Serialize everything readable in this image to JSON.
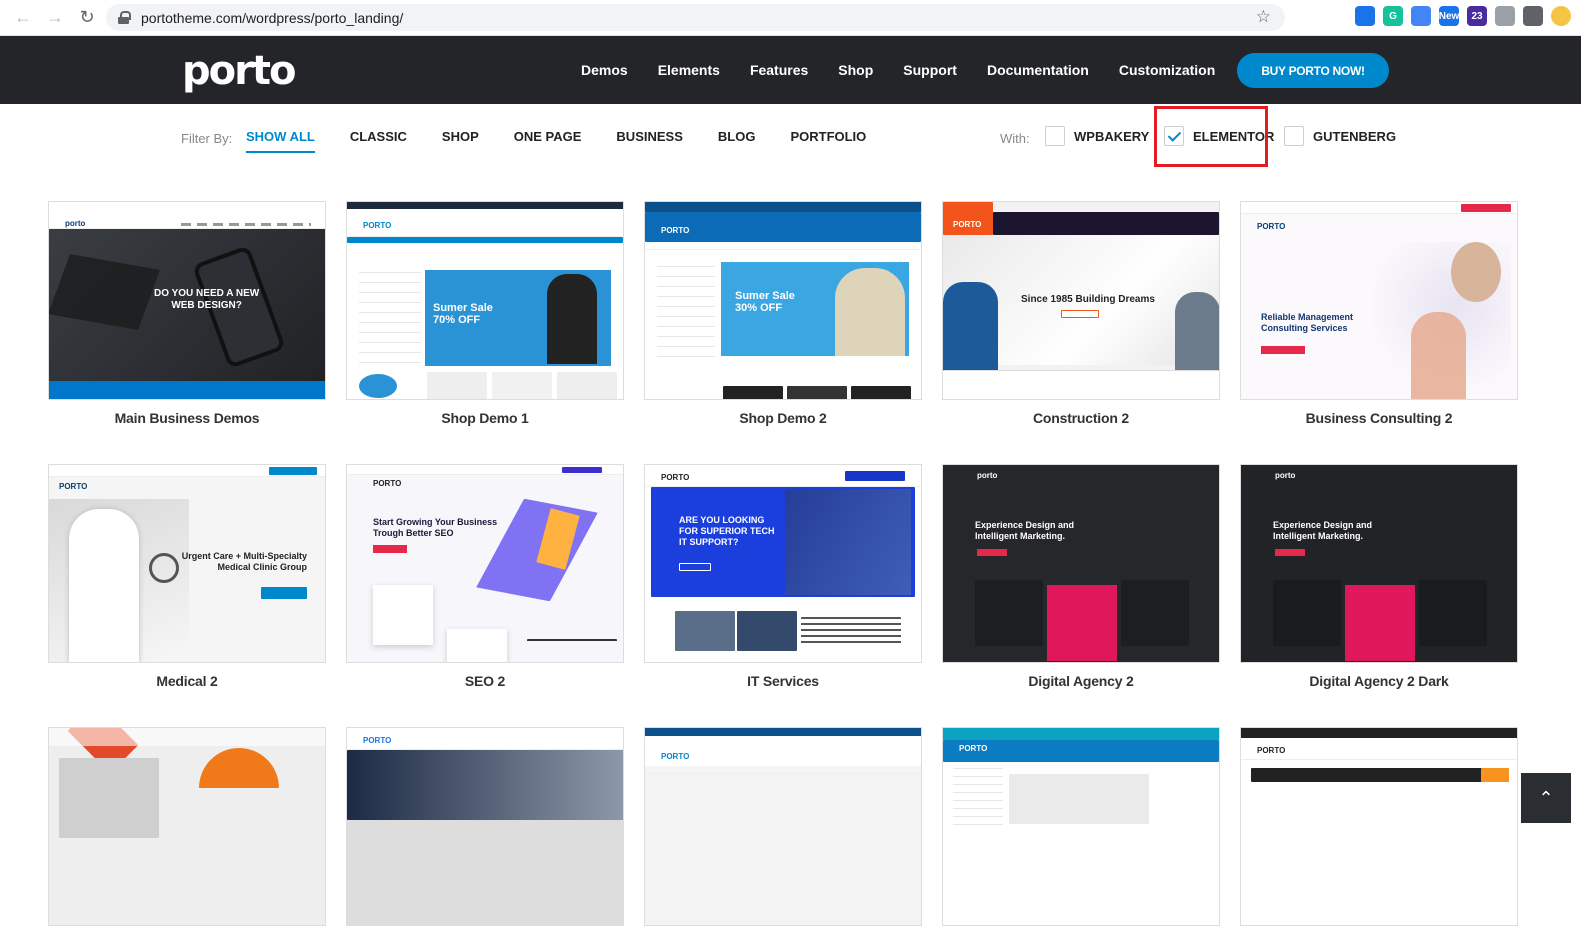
{
  "browser": {
    "url": "portotheme.com/wordpress/porto_landing/",
    "extensions": [
      {
        "name": "share-icon",
        "color": "#1a73e8",
        "label": ""
      },
      {
        "name": "grammarly-icon",
        "color": "#15c39a",
        "label": "G"
      },
      {
        "name": "translate-icon",
        "color": "#4285f4",
        "label": ""
      },
      {
        "name": "new-badge-icon",
        "color": "#1a73e8",
        "label": "New"
      },
      {
        "name": "mortarboard-icon",
        "color": "#4b2ca0",
        "label": "23"
      },
      {
        "name": "globe-icon",
        "color": "#9aa0a6",
        "label": ""
      },
      {
        "name": "puzzle-icon",
        "color": "#5f6368",
        "label": ""
      },
      {
        "name": "profile-avatar-icon",
        "color": "#f4c542",
        "label": ""
      }
    ]
  },
  "header": {
    "logo": "porto",
    "nav": [
      "Demos",
      "Elements",
      "Features",
      "Shop",
      "Support",
      "Documentation",
      "Customization"
    ],
    "buy_label": "BUY PORTO NOW!"
  },
  "filters": {
    "label": "Filter By:",
    "items": [
      "SHOW ALL",
      "CLASSIC",
      "SHOP",
      "ONE PAGE",
      "BUSINESS",
      "BLOG",
      "PORTFOLIO"
    ],
    "active": "SHOW ALL",
    "with_label": "With:",
    "builders": [
      {
        "label": "WPBAKERY",
        "checked": false
      },
      {
        "label": "ELEMENTOR",
        "checked": true
      },
      {
        "label": "GUTENBERG",
        "checked": false
      }
    ]
  },
  "demos": [
    {
      "title": "Main Business Demos",
      "hero": "DO YOU NEED A NEW\nWEB DESIGN?"
    },
    {
      "title": "Shop Demo 1",
      "hero": "Sumer Sale\n70% OFF"
    },
    {
      "title": "Shop Demo 2",
      "hero": "Sumer Sale\n30% OFF"
    },
    {
      "title": "Construction 2",
      "hero": "Since 1985 Building Dreams"
    },
    {
      "title": "Business Consulting 2",
      "hero": "Reliable Management\nConsulting Services"
    },
    {
      "title": "Medical 2",
      "hero": "Urgent Care + Multi-Specialty\nMedical Clinic Group"
    },
    {
      "title": "SEO 2",
      "hero": "Start Growing Your Business\nTrough Better SEO"
    },
    {
      "title": "IT Services",
      "hero": "ARE YOU LOOKING\nFOR SUPERIOR TECH\nIT SUPPORT?"
    },
    {
      "title": "Digital Agency 2",
      "hero": "Experience Design and\nIntelligent Marketing."
    },
    {
      "title": "Digital Agency 2 Dark",
      "hero": "Experience Design and\nIntelligent Marketing."
    }
  ],
  "partial_row": [
    "porto-construction-3",
    "porto-medical-3",
    "porto-shop-3",
    "porto-electronic",
    "porto-shop-4"
  ],
  "colors": {
    "accent": "#0088cc",
    "header_bg": "#232529",
    "highlight": "#e31b23"
  }
}
